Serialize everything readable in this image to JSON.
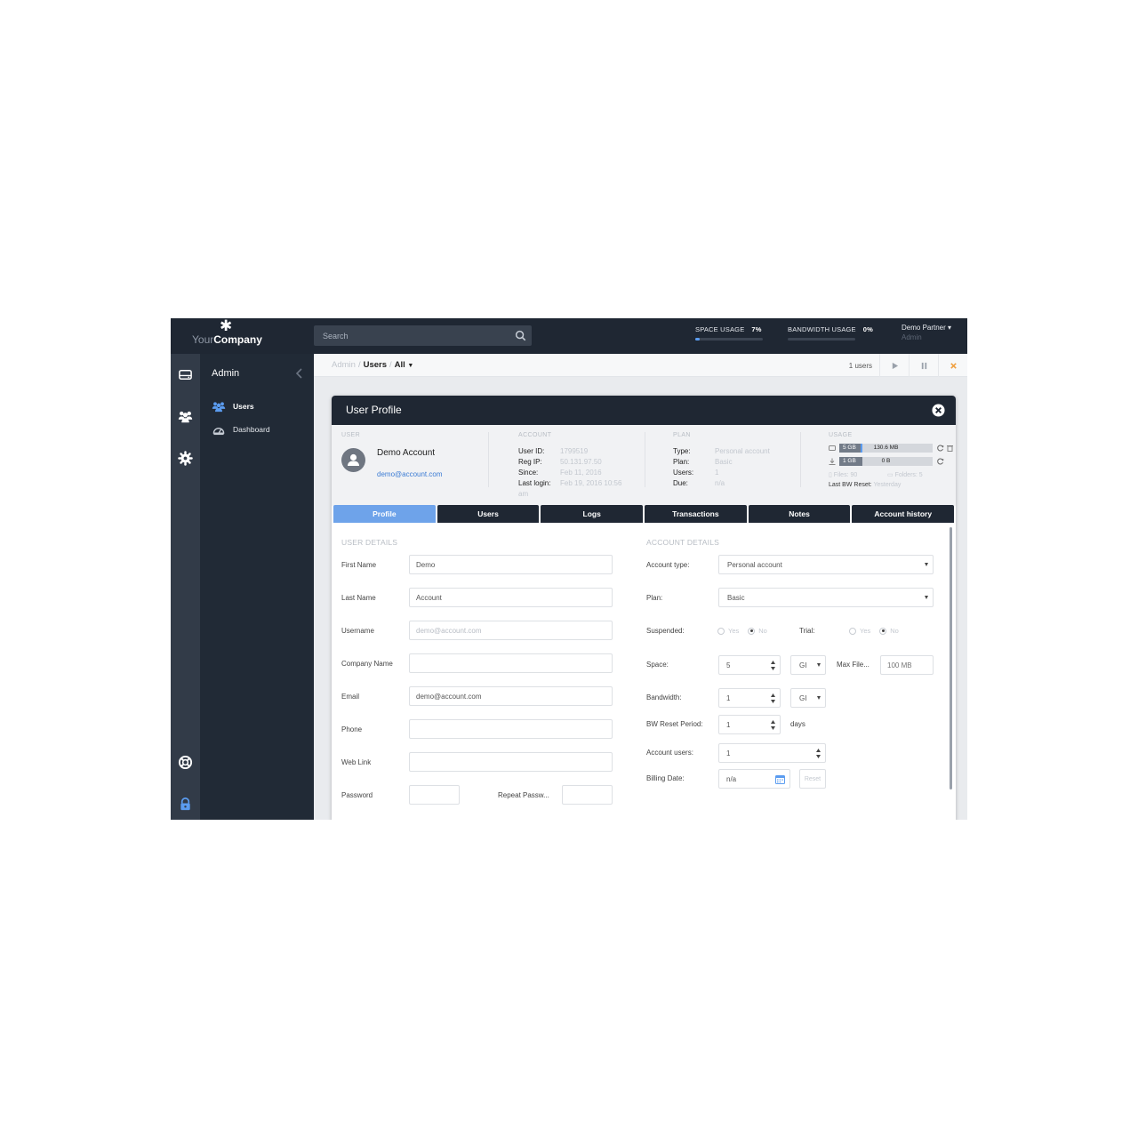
{
  "brand": {
    "name_part1": "Your",
    "name_part2": "Company"
  },
  "search": {
    "placeholder": "Search"
  },
  "top_usage": {
    "space_label": "SPACE USAGE",
    "space_value": "7%",
    "space_fraction": 0.07,
    "bandwidth_label": "BANDWIDTH USAGE",
    "bandwidth_value": "0%",
    "bandwidth_fraction": 0.0,
    "accent_color": "#5b9cf0"
  },
  "user_menu": {
    "name": "Demo Partner",
    "role": "Admin"
  },
  "rail": {
    "icons": [
      "drive-icon",
      "users-icon",
      "gear-icon",
      "lifebuoy-icon",
      "lock-icon"
    ]
  },
  "sidebar": {
    "title": "Admin",
    "items": [
      {
        "label": "Users",
        "icon": "users-icon",
        "active": true
      },
      {
        "label": "Dashboard",
        "icon": "dashboard-icon",
        "active": false
      }
    ]
  },
  "breadcrumb": {
    "root": "Admin",
    "sep": "/",
    "section": "Users",
    "filter": "All"
  },
  "toolbar": {
    "count": "1 users"
  },
  "modal": {
    "title": "User Profile",
    "summary": {
      "user_heading": "USER",
      "account_name": "Demo Account",
      "account_email": "demo@account.com",
      "account_heading": "ACCOUNT",
      "user_id_label": "User ID:",
      "user_id": "1799519",
      "reg_ip_label": "Reg IP:",
      "reg_ip": "50.131.97.50",
      "since_label": "Since:",
      "since": "Feb 11, 2016",
      "last_login_label": "Last login:",
      "last_login": "Feb 19, 2016 10:56",
      "last_login_suffix": "am",
      "plan_heading": "PLAN",
      "type_label": "Type:",
      "type": "Personal account",
      "plan_label": "Plan:",
      "plan": "Basic",
      "users_label": "Users:",
      "users": "1",
      "due_label": "Due:",
      "due": "n/a",
      "usage_heading": "USAGE",
      "space_quota": "5 GB",
      "space_used": "130.6 MB",
      "space_fraction": 0.03,
      "bw_quota": "1 GB",
      "bw_used": "0 B",
      "bw_fraction": 0.0,
      "files": "Files: 90",
      "folders": "Folders: 5",
      "last_bw_reset_label": "Last BW Reset:",
      "last_bw_reset": "Yesterday"
    },
    "tabs": [
      "Profile",
      "Users",
      "Logs",
      "Transactions",
      "Notes",
      "Account history"
    ],
    "active_tab": "Profile",
    "user_details": {
      "heading": "USER DETAILS",
      "first_name_label": "First Name",
      "first_name": "Demo",
      "last_name_label": "Last Name",
      "last_name": "Account",
      "username_label": "Username",
      "username": "demo@account.com",
      "company_label": "Company Name",
      "company": "",
      "email_label": "Email",
      "email": "demo@account.com",
      "phone_label": "Phone",
      "phone": "",
      "web_link_label": "Web Link",
      "web_link": "",
      "password_label": "Password",
      "password": "",
      "repeat_password_label": "Repeat Passw...",
      "repeat_password": ""
    },
    "account_details": {
      "heading": "ACCOUNT DETAILS",
      "account_type_label": "Account type:",
      "account_type": "Personal account",
      "plan_label": "Plan:",
      "plan": "Basic",
      "suspended_label": "Suspended:",
      "suspended": "No",
      "trial_label": "Trial:",
      "trial": "No",
      "yes": "Yes",
      "no": "No",
      "space_label": "Space:",
      "space": "5",
      "space_unit": "GI",
      "max_file_label": "Max File...",
      "max_file_placeholder": "100 MB",
      "bandwidth_label": "Bandwidth:",
      "bandwidth": "1",
      "bandwidth_unit": "GI",
      "bw_reset_label": "BW Reset Period:",
      "bw_reset": "1",
      "bw_reset_unit": "days",
      "account_users_label": "Account users:",
      "account_users": "1",
      "billing_date_label": "Billing Date:",
      "billing_date": "n/a",
      "reset_label": "Reset"
    }
  }
}
